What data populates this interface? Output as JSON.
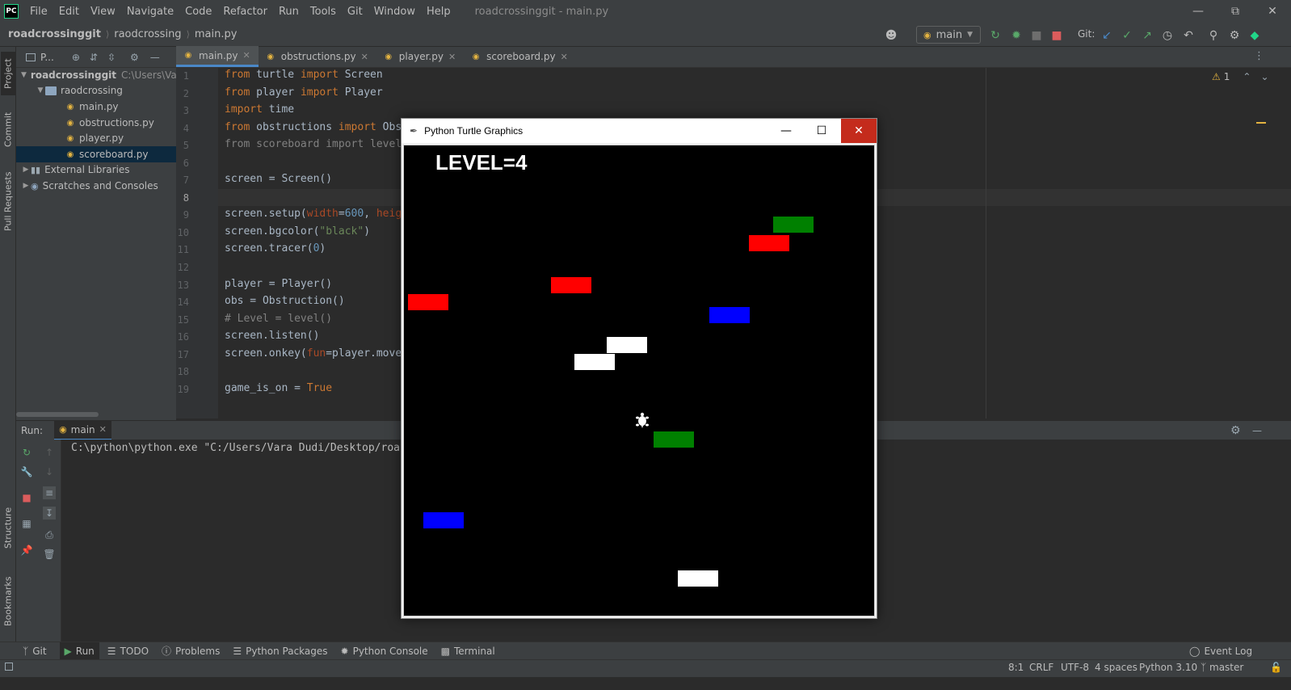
{
  "menubar": {
    "logo": "PC",
    "items": [
      "File",
      "Edit",
      "View",
      "Navigate",
      "Code",
      "Refactor",
      "Run",
      "Tools",
      "Git",
      "Window",
      "Help"
    ],
    "window_title": "roadcrossinggit - main.py"
  },
  "navbar": {
    "breadcrumbs": [
      "roadcrossinggit",
      "raodcrossing",
      "main.py"
    ],
    "run_config": "main",
    "git_label": "Git:"
  },
  "left_strip": {
    "tabs": [
      "Project",
      "Commit",
      "Pull Requests",
      "Structure",
      "Bookmarks"
    ]
  },
  "project": {
    "header": "P...",
    "root": {
      "name": "roadcrossinggit",
      "path": "C:\\Users\\Var"
    },
    "folder": "raodcrossing",
    "files": [
      "main.py",
      "obstructions.py",
      "player.py",
      "scoreboard.py"
    ],
    "selected": "scoreboard.py",
    "external": "External Libraries",
    "scratches": "Scratches and Consoles"
  },
  "editor": {
    "tabs": [
      "main.py",
      "obstructions.py",
      "player.py",
      "scoreboard.py"
    ],
    "active_tab": "main.py",
    "warning_count": "1",
    "line_numbers": [
      "1",
      "2",
      "3",
      "4",
      "5",
      "6",
      "7",
      "8",
      "9",
      "10",
      "11",
      "12",
      "13",
      "14",
      "15",
      "16",
      "17",
      "18",
      "19"
    ]
  },
  "run": {
    "label": "Run:",
    "tab": "main",
    "console_line": "C:\\python\\python.exe \"C:/Users/Vara Dudi/Desktop/roa"
  },
  "bottom_tools": [
    "Git",
    "Run",
    "TODO",
    "Problems",
    "Python Packages",
    "Python Console",
    "Terminal"
  ],
  "event_log": "Event Log",
  "status": {
    "position": "8:1",
    "line_sep": "CRLF",
    "encoding": "UTF-8",
    "indent": "4 spaces",
    "interpreter": "Python 3.10",
    "branch": "master"
  },
  "turtle": {
    "title": "Python Turtle Graphics",
    "level_text": "LEVEL=4",
    "colors": {
      "red": "#ff0000",
      "green": "#008000",
      "blue": "#0000ff",
      "white": "#ffffff",
      "background": "#000000"
    }
  }
}
